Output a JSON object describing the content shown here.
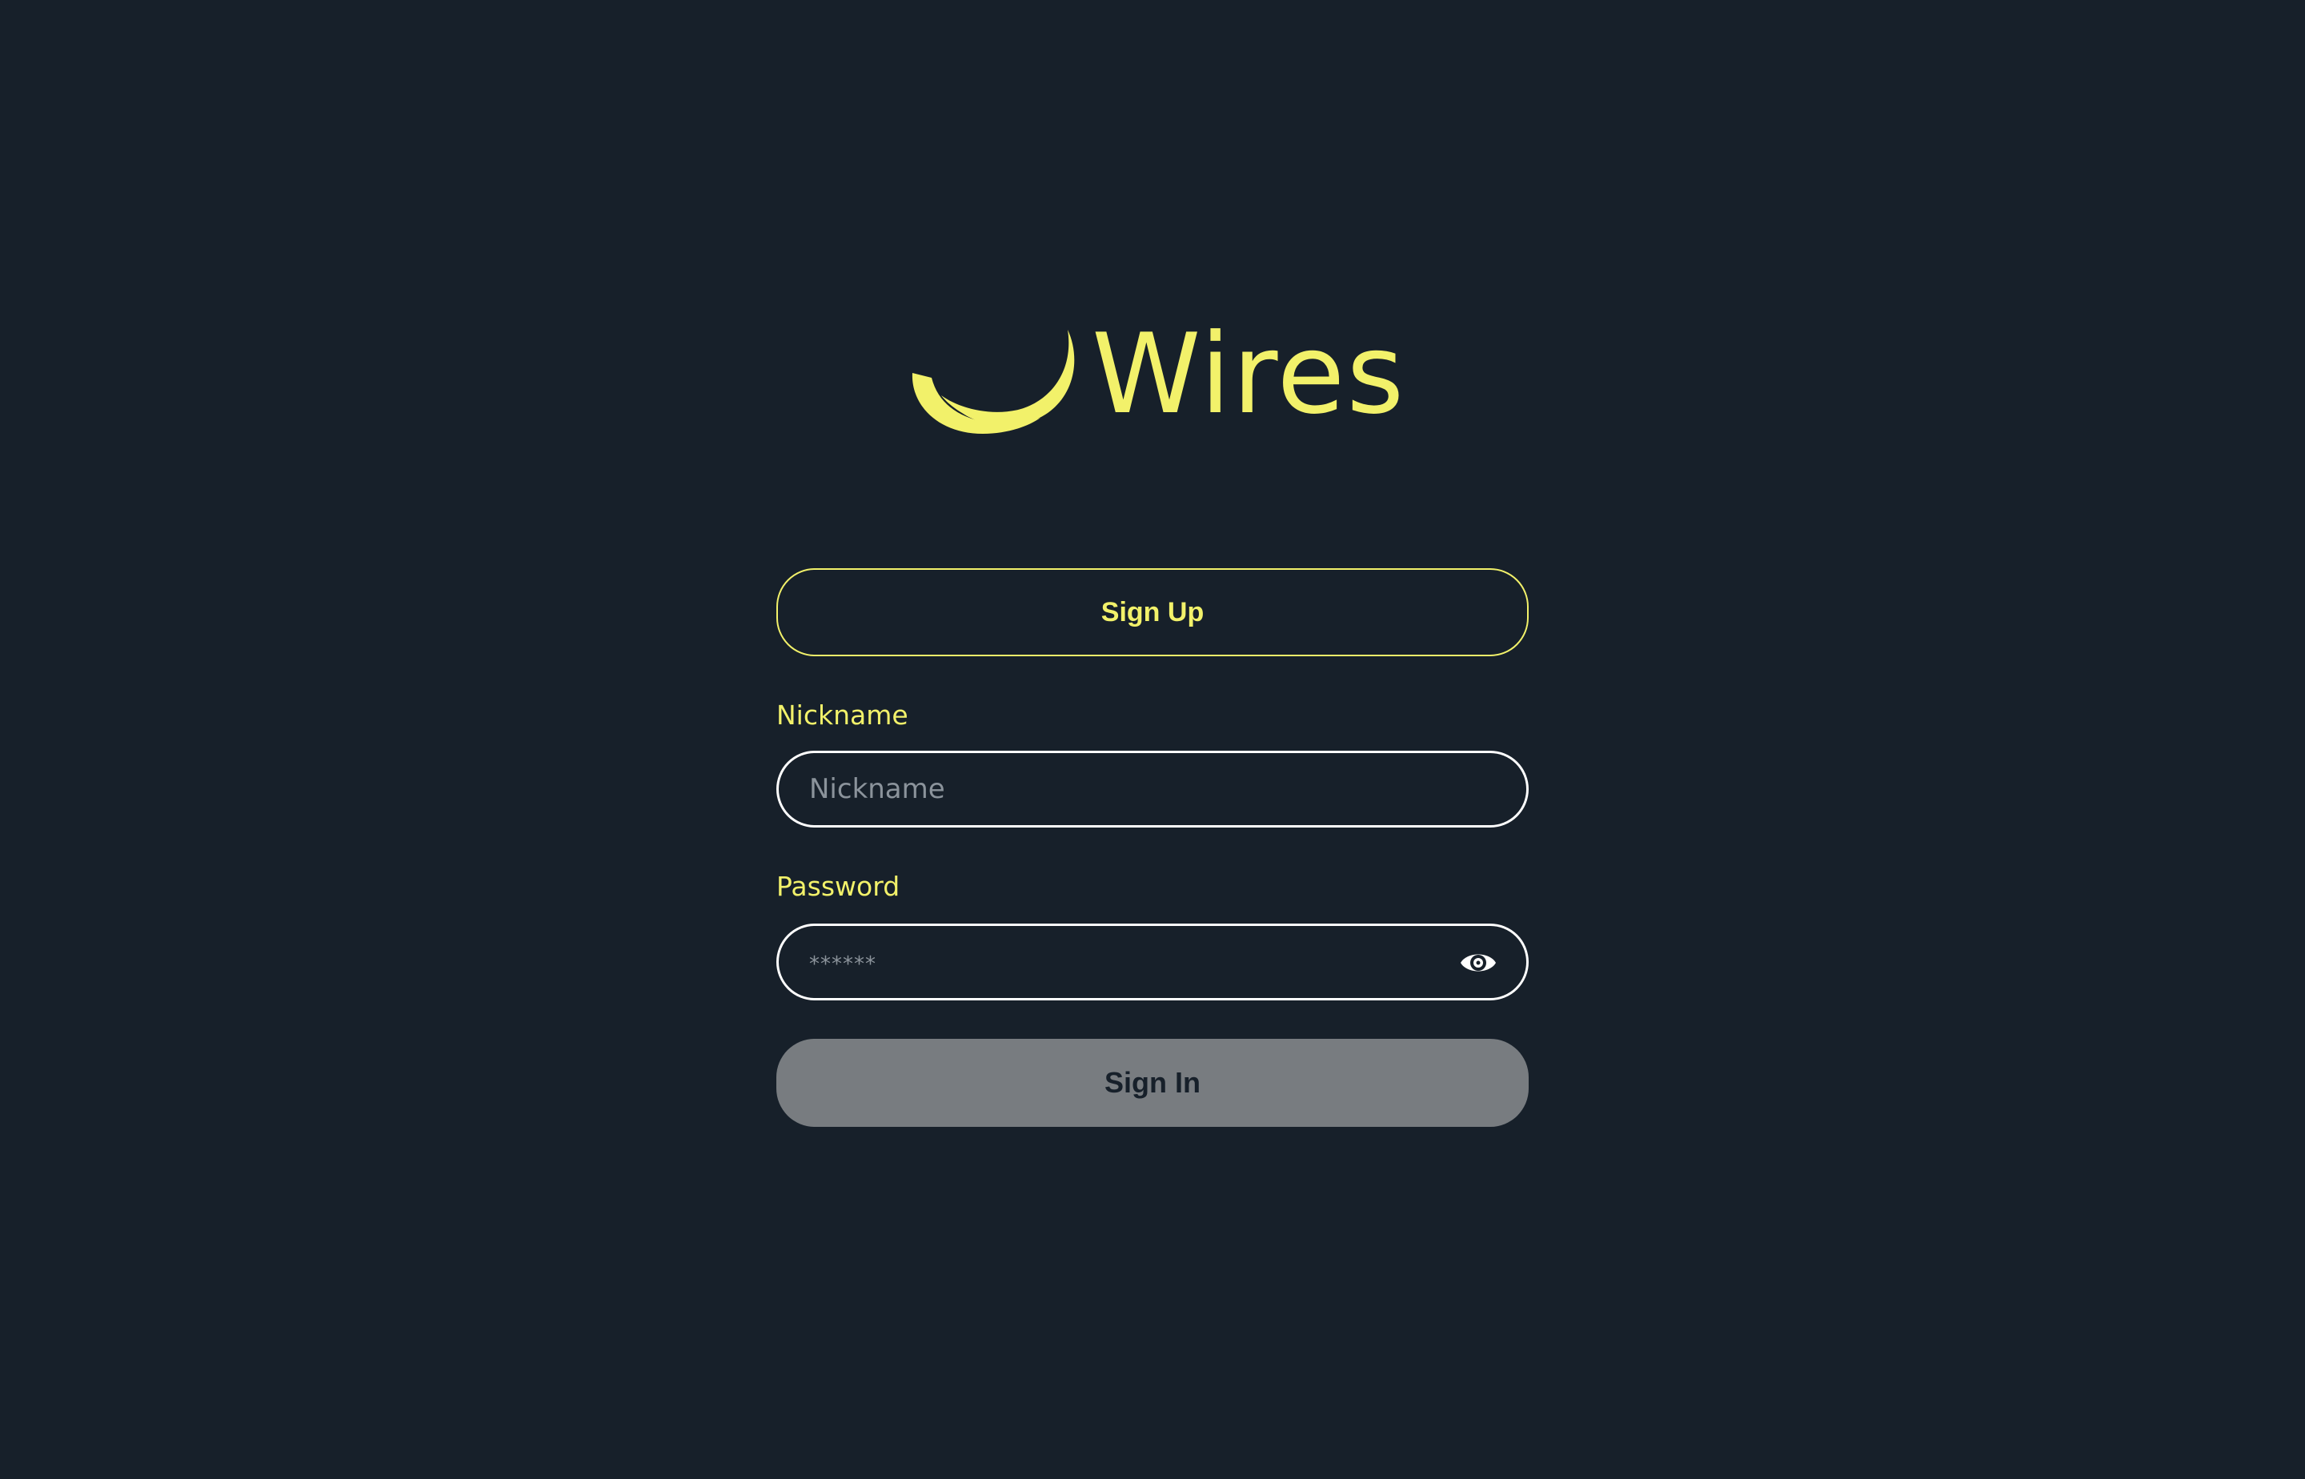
{
  "brand": {
    "name": "Wires",
    "logo_icon": "wires-crescent-logo",
    "accent_color": "#f2f16a"
  },
  "colors": {
    "background": "#17202a",
    "input_border": "#ffffff",
    "disabled_button": "#787c80"
  },
  "form": {
    "signup_label": "Sign Up",
    "nickname": {
      "label": "Nickname",
      "placeholder": "Nickname",
      "value": ""
    },
    "password": {
      "label": "Password",
      "placeholder": "******",
      "value": "",
      "toggle_icon": "eye-icon"
    },
    "signin_label": "Sign In"
  }
}
